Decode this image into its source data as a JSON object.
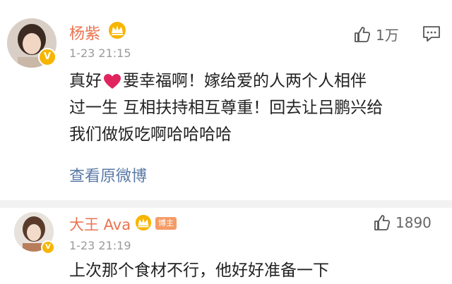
{
  "comments": [
    {
      "username": "杨紫",
      "avatar_icon": "avatar-photo",
      "badge_icon": "crown-vip-icon",
      "verified_icon": "verified-v-icon",
      "verified_glyph": "V",
      "timestamp": "1-23 21:15",
      "likes": "1万",
      "body_before_heart": "真好",
      "body_after_heart": "要幸福啊！嫁给爱的人两个人相伴",
      "body_line2": "过一生 互相扶持相互尊重！回去让吕鹏兴给",
      "body_line3": "我们做饭吃啊哈哈哈哈",
      "view_original": "查看原微博"
    },
    {
      "username": "大王 Ava",
      "avatar_icon": "avatar-photo",
      "badge_icon": "crown-vip-icon",
      "tag": "博主",
      "verified_icon": "verified-v-icon",
      "verified_glyph": "V",
      "timestamp": "1-23 21:19",
      "likes": "1890",
      "body_line1": "上次那个食材不行，他好好准备一下"
    }
  ],
  "colors": {
    "username": "#eb7350",
    "link": "#5a79a6",
    "timestamp": "#9b9b9b",
    "heart": "#e0245e",
    "crown": "#f7b500"
  }
}
